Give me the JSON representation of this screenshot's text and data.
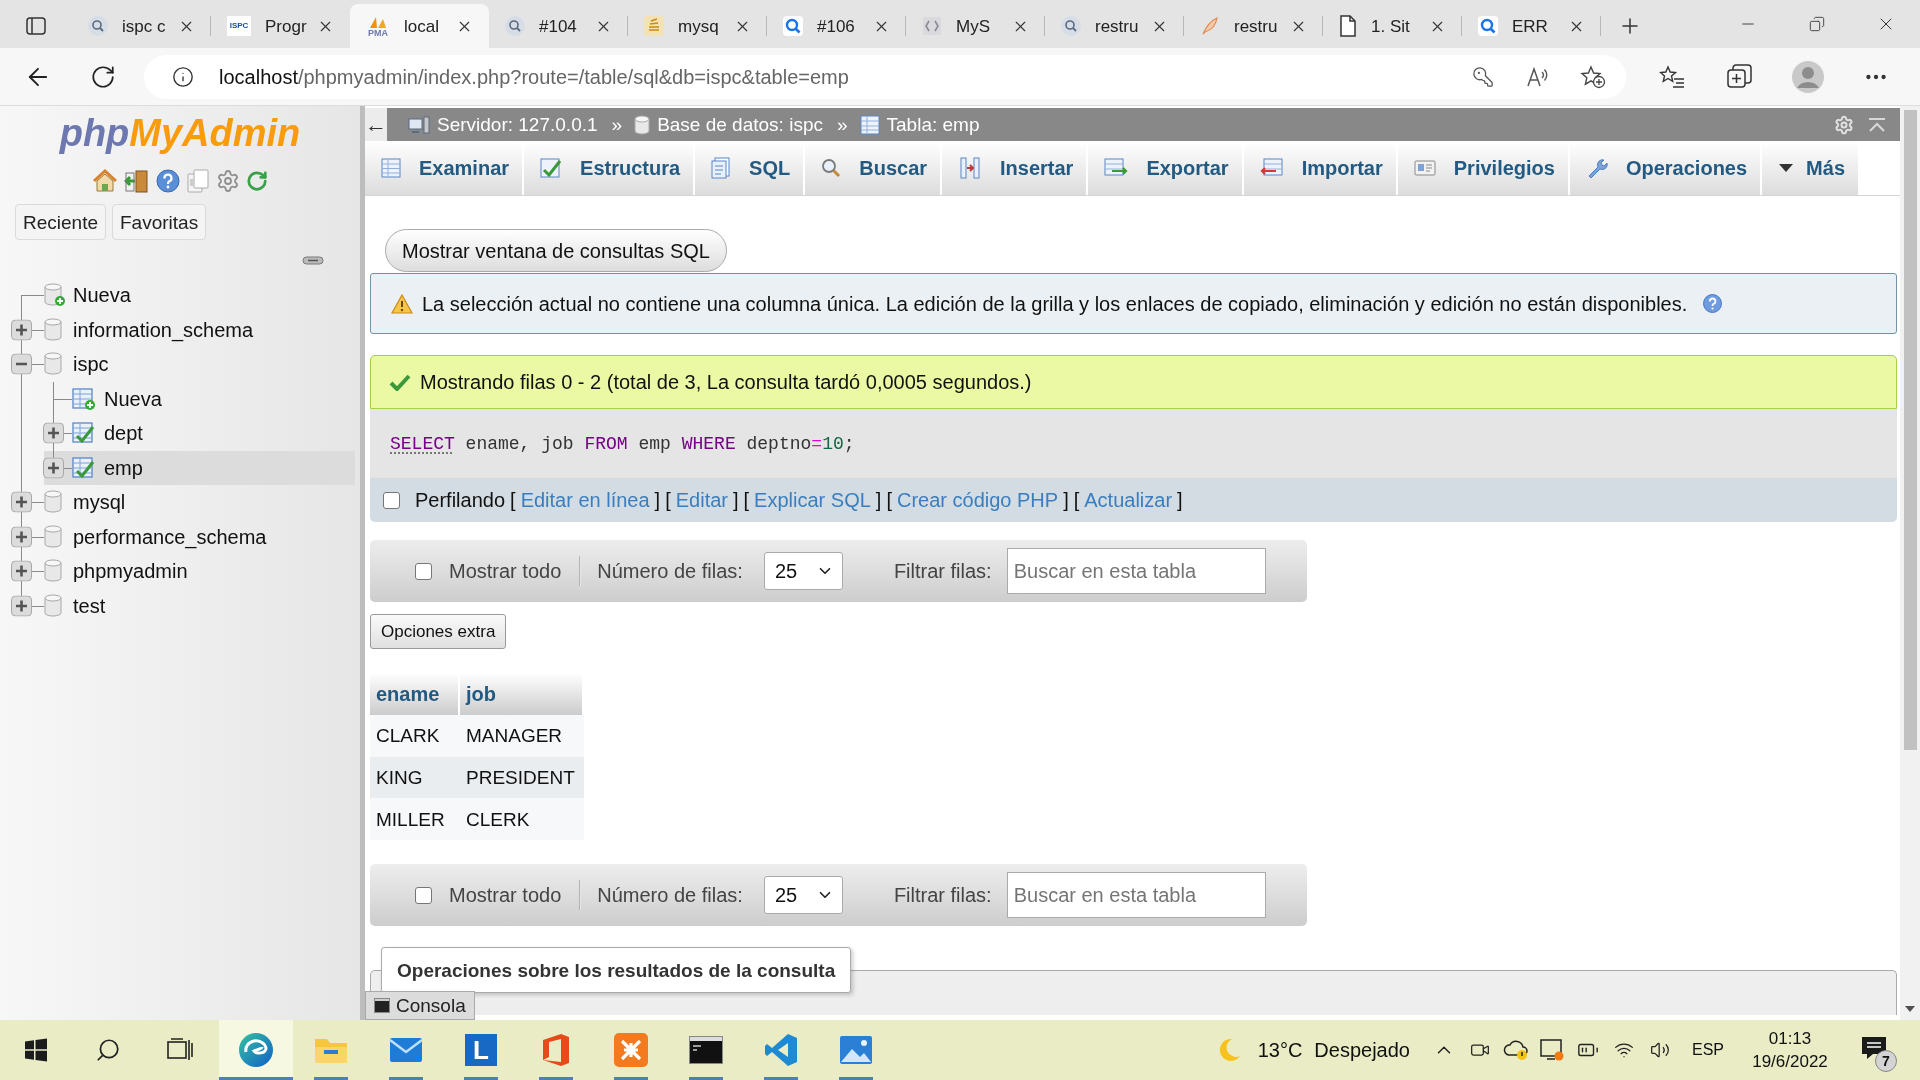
{
  "browser": {
    "tabs": [
      {
        "title": "ispc c",
        "kind": "search",
        "selected": false
      },
      {
        "title": "Progr",
        "kind": "badge",
        "badge": "ISPC",
        "selected": false
      },
      {
        "title": "local",
        "kind": "sail",
        "badge": "PMA",
        "selected": true
      },
      {
        "title": "#104",
        "kind": "search",
        "selected": false
      },
      {
        "title": "mysq",
        "kind": "stack",
        "selected": false
      },
      {
        "title": "#106",
        "kind": "query",
        "selected": false
      },
      {
        "title": "MyS",
        "kind": "docs",
        "selected": false
      },
      {
        "title": "restru",
        "kind": "search",
        "selected": false
      },
      {
        "title": "restru",
        "kind": "feather",
        "selected": false
      },
      {
        "title": "1. Sit",
        "kind": "page",
        "selected": false
      },
      {
        "title": "ERR",
        "kind": "query",
        "selected": false
      }
    ],
    "address": {
      "host": "localhost",
      "path": "/phpmyadmin/index.php?route=/table/sql&db=ispc&table=emp"
    }
  },
  "sidebar": {
    "logo": [
      "php",
      "MyAdmin"
    ],
    "buttons": [
      "Reciente",
      "Favoritas"
    ],
    "tree": [
      {
        "label": "Nueva",
        "kind": "newdb",
        "selected": false
      },
      {
        "label": "information_schema",
        "kind": "db",
        "expanded": false,
        "selected": false
      },
      {
        "label": "ispc",
        "kind": "db",
        "expanded": true,
        "selected": false,
        "children": [
          {
            "label": "Nueva",
            "kind": "newtable",
            "selected": false
          },
          {
            "label": "dept",
            "kind": "table",
            "expanded": false,
            "selected": false
          },
          {
            "label": "emp",
            "kind": "table",
            "expanded": false,
            "selected": true
          }
        ]
      },
      {
        "label": "mysql",
        "kind": "db",
        "expanded": false,
        "selected": false
      },
      {
        "label": "performance_schema",
        "kind": "db",
        "expanded": false,
        "selected": false
      },
      {
        "label": "phpmyadmin",
        "kind": "db",
        "expanded": false,
        "selected": false
      },
      {
        "label": "test",
        "kind": "db",
        "expanded": false,
        "selected": false
      }
    ]
  },
  "breadcrumb": {
    "toggle": "←",
    "items": [
      {
        "kind": "server",
        "label": "Servidor: 127.0.0.1",
        "separator": "»"
      },
      {
        "kind": "database",
        "label": "Base de datos: ispc",
        "separator": "»"
      },
      {
        "kind": "table",
        "label": "Tabla: emp"
      }
    ]
  },
  "menu": [
    "Examinar",
    "Estructura",
    "SQL",
    "Buscar",
    "Insertar",
    "Exportar",
    "Importar",
    "Privilegios",
    "Operaciones",
    "Más"
  ],
  "content": {
    "query_window_button": "Mostrar ventana de consultas SQL",
    "notice": "La selección actual no contiene una columna única. La edición de la grilla y los enlaces de copiado, eliminación y edición no están disponibles.",
    "success": "Mostrando filas 0 - 2 (total de 3, La consulta tardó 0,0005 segundos.)",
    "sql": [
      {
        "text": "SELECT",
        "kind": "link"
      },
      {
        "text": " ename, job ",
        "kind": "plain"
      },
      {
        "text": "FROM",
        "kind": "keyword"
      },
      {
        "text": " emp ",
        "kind": "plain"
      },
      {
        "text": "WHERE",
        "kind": "keyword"
      },
      {
        "text": " deptno",
        "kind": "plain"
      },
      {
        "text": "=",
        "kind": "operator"
      },
      {
        "text": "10",
        "kind": "number"
      },
      {
        "text": ";",
        "kind": "plain"
      }
    ],
    "profiling": {
      "label": "Perfilando",
      "checked": false
    },
    "actions": [
      {
        "open": "[",
        "label": "Editar en línea",
        "close": "]"
      },
      {
        "open": "[",
        "label": "Editar",
        "close": "]"
      },
      {
        "open": "[",
        "label": "Explicar SQL",
        "close": "]"
      },
      {
        "open": "[",
        "label": "Crear código PHP",
        "close": "]"
      },
      {
        "open": "[",
        "label": "Actualizar",
        "close": "]"
      }
    ],
    "navigation_top": {
      "show_all": {
        "label": "Mostrar todo",
        "checked": false
      },
      "rows": {
        "label": "Número de filas:",
        "value": "25"
      },
      "filter": {
        "label": "Filtrar filas:",
        "placeholder": "Buscar en esta tabla"
      }
    },
    "extra_options": "Opciones extra",
    "table": {
      "columns": [
        "ename",
        "job"
      ],
      "rows": [
        [
          "CLARK",
          "MANAGER"
        ],
        [
          "KING",
          "PRESIDENT"
        ],
        [
          "MILLER",
          "CLERK"
        ]
      ]
    },
    "navigation_bottom": {
      "show_all": {
        "label": "Mostrar todo",
        "checked": false
      },
      "rows": {
        "label": "Número de filas:",
        "value": "25"
      },
      "filter": {
        "label": "Filtrar filas:",
        "placeholder": "Buscar en esta tabla"
      }
    },
    "operations_legend": "Operaciones sobre los resultados de la consulta"
  },
  "console": {
    "label": "Consola"
  },
  "taskbar": {
    "apps": [
      {
        "kind": "browser",
        "running": true,
        "selected": true
      },
      {
        "kind": "folder",
        "running": true,
        "selected": false
      },
      {
        "kind": "mail",
        "running": true,
        "selected": false
      },
      {
        "kind": "letter",
        "glyph": "L",
        "running": true,
        "selected": false
      },
      {
        "kind": "office",
        "running": true,
        "selected": false
      },
      {
        "kind": "xampp",
        "running": true,
        "selected": false
      },
      {
        "kind": "terminal",
        "running": true,
        "selected": false
      },
      {
        "kind": "code",
        "running": true,
        "selected": false
      },
      {
        "kind": "photos",
        "running": true,
        "selected": false
      }
    ],
    "weather": {
      "temperature": "13°C",
      "condition": "Despejado"
    },
    "language": "ESP",
    "time": "01:13",
    "date": "19/6/2022",
    "notifications": "7"
  }
}
